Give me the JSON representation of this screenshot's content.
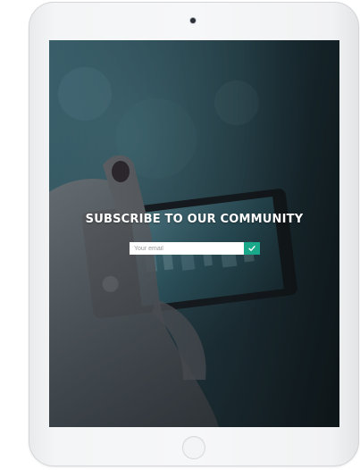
{
  "hero": {
    "headline": "SUBSCRIBE TO OUR COMMUNITY"
  },
  "form": {
    "email_placeholder": "Your email",
    "email_value": "",
    "submit_icon": "checkmark-icon"
  },
  "colors": {
    "accent": "#1aa88a",
    "tablet_frame": "#f4f5f6",
    "screen_overlay": "#263036"
  }
}
